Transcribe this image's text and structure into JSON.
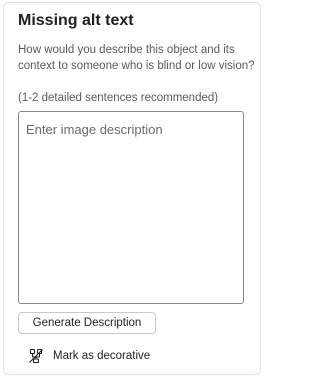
{
  "panel": {
    "title": "Missing alt text",
    "subtitle": "How would you describe this object and its context to someone who is blind or low vision?",
    "hint": "(1-2 detailed sentences recommended)",
    "description": {
      "value": "",
      "placeholder": "Enter image description"
    },
    "generate_button_label": "Generate Description",
    "mark_decorative": {
      "label": "Mark as decorative",
      "icon": "decorative-icon"
    }
  }
}
